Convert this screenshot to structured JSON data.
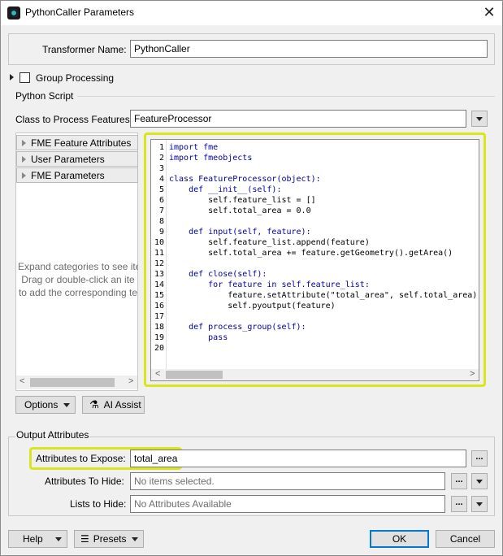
{
  "window": {
    "title": "PythonCaller Parameters",
    "close_glyph": "✕"
  },
  "transformer": {
    "label": "Transformer Name:",
    "value": "PythonCaller"
  },
  "group_processing": {
    "label": "Group Processing",
    "checked": false
  },
  "python_script": {
    "section_label": "Python Script",
    "class_label": "Class to Process Features:",
    "class_value": "FeatureProcessor"
  },
  "tree": {
    "items": [
      {
        "label": "FME Feature Attributes"
      },
      {
        "label": "User Parameters"
      },
      {
        "label": "FME Parameters"
      }
    ],
    "hint_lines": [
      "Expand categories to see ite",
      "Drag or double-click an ite",
      "to add the corresponding te"
    ]
  },
  "code": {
    "line_numbers": [
      "1",
      "2",
      "3",
      "4",
      "5",
      "6",
      "7",
      "8",
      "9",
      "10",
      "11",
      "12",
      "13",
      "14",
      "15",
      "16",
      "17",
      "18",
      "19",
      "20"
    ],
    "lines": [
      "import fme",
      "import fmeobjects",
      "",
      "class FeatureProcessor(object):",
      "    def __init__(self):",
      "        self.feature_list = []",
      "        self.total_area = 0.0",
      "",
      "    def input(self, feature):",
      "        self.feature_list.append(feature)",
      "        self.total_area += feature.getGeometry().getArea()",
      "",
      "    def close(self):",
      "        for feature in self.feature_list:",
      "            feature.setAttribute(\"total_area\", self.total_area)",
      "            self.pyoutput(feature)",
      "",
      "    def process_group(self):",
      "        pass",
      ""
    ]
  },
  "tools": {
    "options_label": "Options",
    "ai_assist_label": "AI Assist"
  },
  "output": {
    "section_label": "Output Attributes",
    "expose_label": "Attributes to Expose:",
    "expose_value": "total_area",
    "hide_label": "Attributes To Hide:",
    "hide_placeholder": "No items selected.",
    "lists_label": "Lists to Hide:",
    "lists_placeholder": "No Attributes Available",
    "dots": "..."
  },
  "footer": {
    "help_label": "Help",
    "presets_label": "Presets",
    "ok_label": "OK",
    "cancel_label": "Cancel"
  },
  "colors": {
    "highlight": "#dbe51e",
    "ok_border": "#0078d7"
  }
}
